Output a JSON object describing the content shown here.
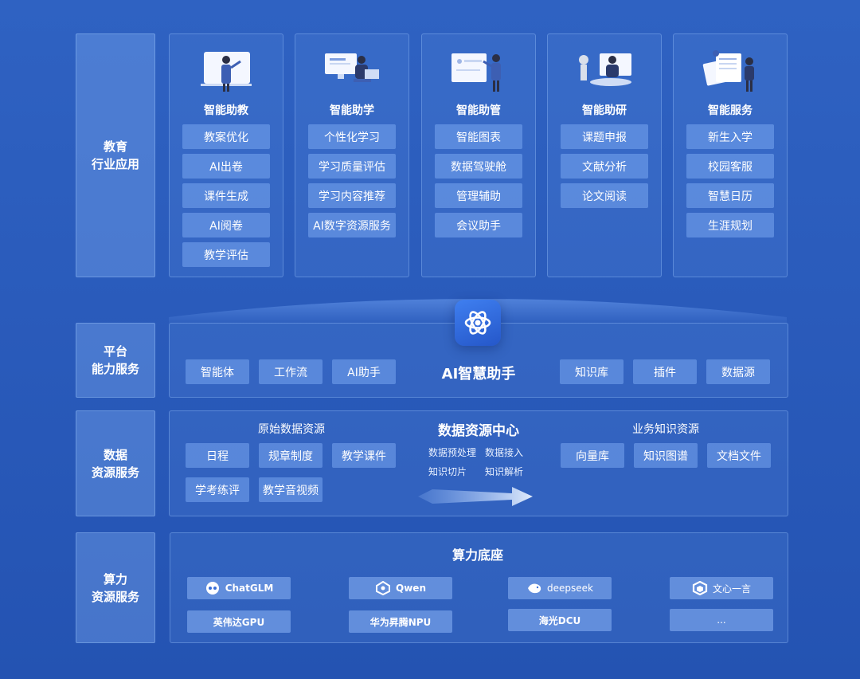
{
  "layers": {
    "education": [
      "教育",
      "行业应用"
    ],
    "platform": [
      "平台",
      "能力服务"
    ],
    "data": [
      "数据",
      "资源服务"
    ],
    "compute": [
      "算力",
      "资源服务"
    ]
  },
  "apps": [
    {
      "title": "智能助教",
      "items": [
        "教案优化",
        "AI出卷",
        "课件生成",
        "AI阅卷",
        "教学评估"
      ]
    },
    {
      "title": "智能助学",
      "items": [
        "个性化学习",
        "学习质量评估",
        "学习内容推荐",
        "AI数字资源服务"
      ]
    },
    {
      "title": "智能助管",
      "items": [
        "智能图表",
        "数据驾驶舱",
        "管理辅助",
        "会议助手"
      ]
    },
    {
      "title": "智能助研",
      "items": [
        "课题申报",
        "文献分析",
        "论文阅读"
      ]
    },
    {
      "title": "智能服务",
      "items": [
        "新生入学",
        "校园客服",
        "智慧日历",
        "生涯规划"
      ]
    }
  ],
  "platform": {
    "title": "AI智慧助手",
    "left": [
      "智能体",
      "工作流",
      "AI助手"
    ],
    "right": [
      "知识库",
      "插件",
      "数据源"
    ]
  },
  "data_center": {
    "title": "数据资源中心",
    "raw_title": "原始数据资源",
    "raw": [
      "日程",
      "规章制度",
      "教学课件",
      "学考练评",
      "教学音视频"
    ],
    "process": [
      "数据预处理",
      "数据接入",
      "知识切片",
      "知识解析"
    ],
    "biz_title": "业务知识资源",
    "biz": [
      "向量库",
      "知识图谱",
      "文档文件"
    ]
  },
  "compute": {
    "title": "算力底座",
    "models": [
      "ChatGLM",
      "Qwen",
      "deepseek",
      "文心一言"
    ],
    "hardware": [
      "英伟达GPU",
      "华为昇腾NPU",
      "海光DCU",
      "..."
    ]
  },
  "colors": {
    "background": "#2a5bbb",
    "chip": "#6f9de8",
    "panel": "#3d70cf",
    "logo_bg": "#2f69d9"
  }
}
